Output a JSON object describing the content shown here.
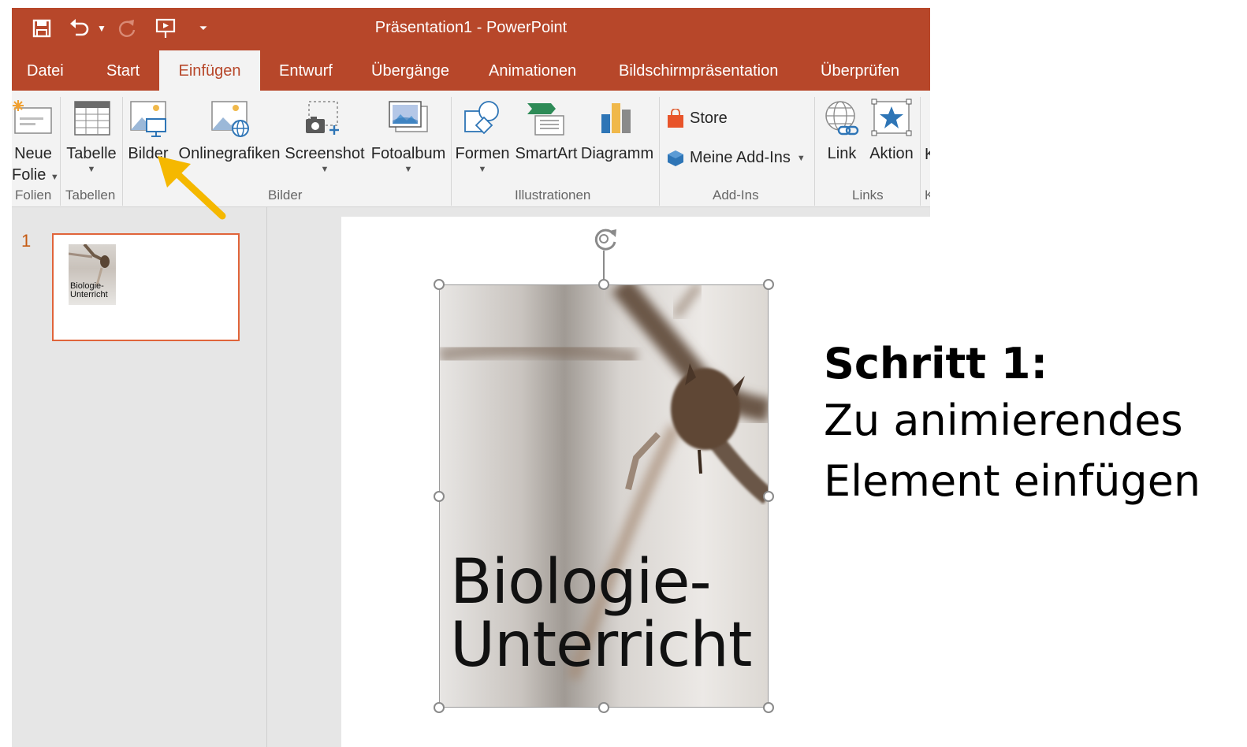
{
  "window": {
    "title": "Präsentation1  -  PowerPoint"
  },
  "qat": {
    "save_icon": "save-icon",
    "undo_icon": "undo-icon",
    "redo_icon": "redo-icon",
    "present_icon": "present-from-start-icon",
    "customize_icon": "customize-qat-icon"
  },
  "tabs": [
    {
      "label": "Datei"
    },
    {
      "label": "Start"
    },
    {
      "label": "Einfügen"
    },
    {
      "label": "Entwurf"
    },
    {
      "label": "Übergänge"
    },
    {
      "label": "Animationen"
    },
    {
      "label": "Bildschirmpräsentation"
    },
    {
      "label": "Überprüfen"
    }
  ],
  "active_tab": "Einfügen",
  "ribbon": {
    "new_slide_line1": "Neue",
    "new_slide_line2": "Folie",
    "table": "Tabelle",
    "pictures": "Bilder",
    "online_pictures": "Onlinegrafiken",
    "screenshot": "Screenshot",
    "photo_album": "Fotoalbum",
    "shapes": "Formen",
    "smartart": "SmartArt",
    "chart": "Diagramm",
    "store": "Store",
    "my_addins": "Meine Add-Ins",
    "link": "Link",
    "action": "Aktion",
    "cut_off": "K",
    "groups": {
      "slides": "Folien",
      "tables": "Tabellen",
      "images": "Bilder",
      "illustrations": "Illustrationen",
      "addins": "Add-Ins",
      "links": "Links",
      "cut_off": "K"
    }
  },
  "slides_pane": {
    "slide_number": "1",
    "thumb_text_line1": "Biologie-",
    "thumb_text_line2": "Unterricht"
  },
  "slide": {
    "picture_text_line1": "Biologie-",
    "picture_text_line2": "Unterricht"
  },
  "annotation": {
    "heading": "Schritt 1:",
    "line1": "Zu animierendes",
    "line2": "Element einfügen",
    "arrow_color": "#f5b800"
  },
  "colors": {
    "accent": "#b7472a",
    "selection": "#e0643a"
  }
}
